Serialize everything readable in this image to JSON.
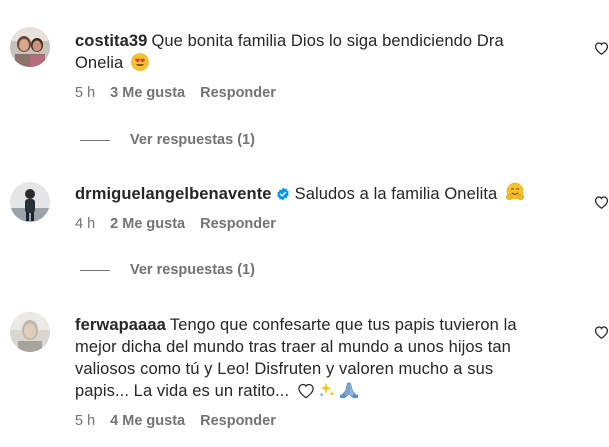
{
  "comments": [
    {
      "username": "costita39",
      "text": "Que bonita familia Dios lo siga bendiciendo Dra",
      "text_line2": "Onelia",
      "emoji": "heart-eyes-emoji",
      "time": "5 h",
      "likes": "3 Me gusta",
      "reply_label": "Responder",
      "view_replies": "Ver respuestas (1)"
    },
    {
      "username": "drmiguelangelbenavente",
      "verified": true,
      "text": "Saludos a la familia Onelita",
      "emoji": "hugging-emoji",
      "time": "4 h",
      "likes": "2 Me gusta",
      "reply_label": "Responder",
      "view_replies": "Ver respuestas (1)"
    },
    {
      "username": "ferwapaaaa",
      "text_line1": "Tengo que confesarte que tus papis tuvieron la",
      "text_line2": "mejor dicha del mundo tras traer al mundo a unos hijos tan",
      "text_line3": "valiosos como tú y Leo! Disfruten y valoren mucho a sus",
      "text_line4": "papis... La vida es un ratito...",
      "emojis": [
        "white-heart-emoji",
        "sparkles-emoji",
        "folded-hands-emoji"
      ],
      "time": "5 h",
      "likes": "4 Me gusta",
      "reply_label": "Responder"
    }
  ],
  "colors": {
    "text": "#262626",
    "secondary": "#737373",
    "verified": "#0095f6",
    "background": "#ffffff"
  }
}
